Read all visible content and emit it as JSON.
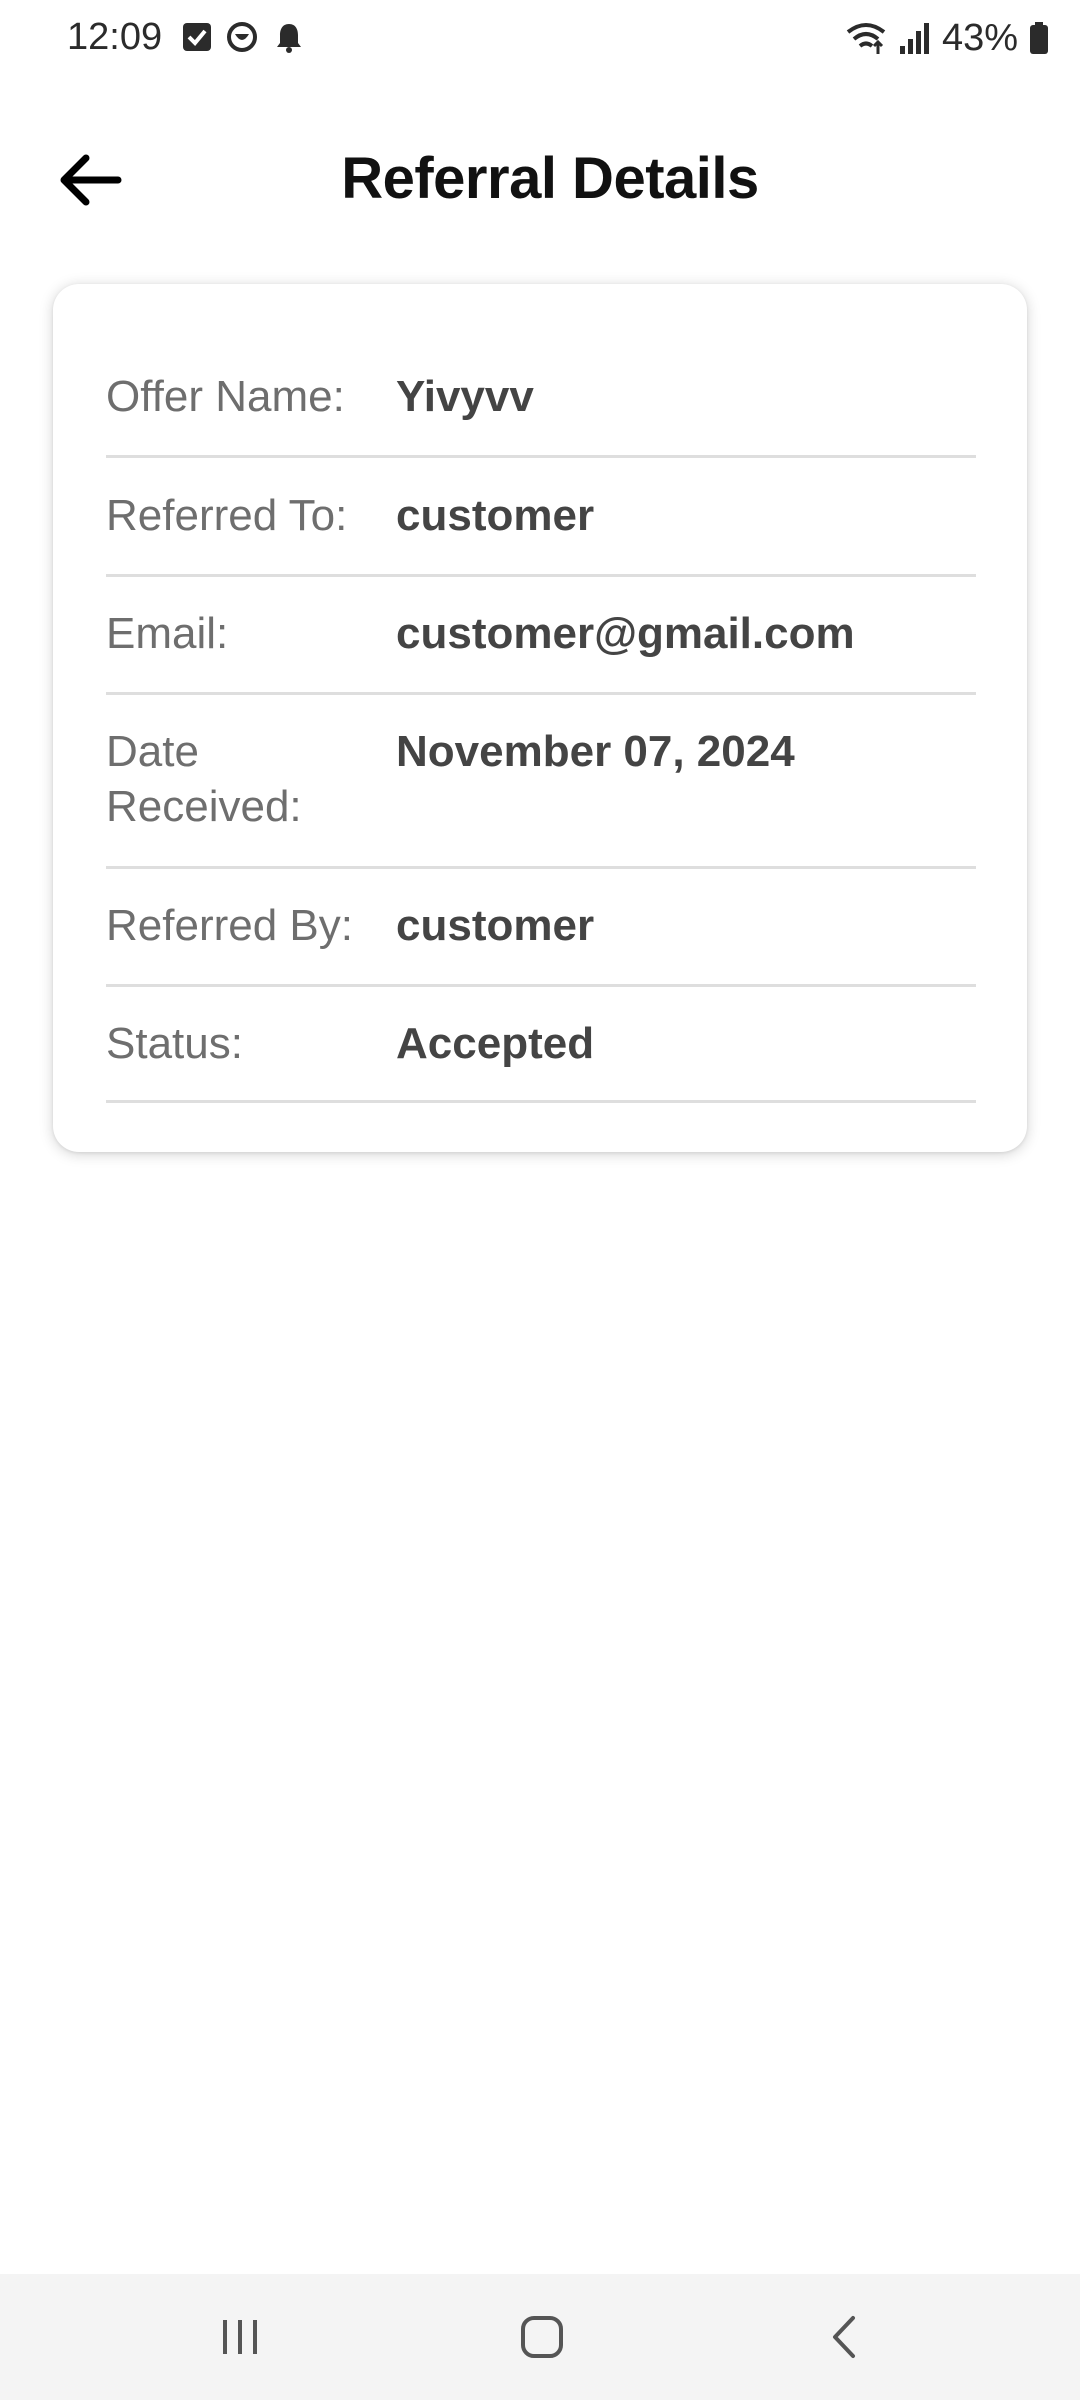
{
  "status_bar": {
    "time": "12:09",
    "battery": "43%",
    "icons": [
      "checkbox-notification-icon",
      "smile-notification-icon",
      "bell-icon",
      "wifi-icon",
      "signal-icon",
      "battery-icon"
    ]
  },
  "header": {
    "title": "Referral Details",
    "back_icon": "arrow-left-icon"
  },
  "details": [
    {
      "label": "Offer Name:",
      "value": "Yivyvv"
    },
    {
      "label": "Referred To:",
      "value": "customer"
    },
    {
      "label": "Email:",
      "value": "customer@gmail.com"
    },
    {
      "label": "Date Received:",
      "value": "November 07, 2024"
    },
    {
      "label": "Referred By:",
      "value": "customer"
    },
    {
      "label": "Status:",
      "value": "Accepted"
    }
  ],
  "nav_bar": {
    "icons": [
      "recent-apps-icon",
      "home-icon",
      "back-icon"
    ]
  },
  "colors": {
    "label": "#6e6e6e",
    "value": "#444444",
    "divider": "#dedede",
    "nav_background": "#f4f4f4"
  }
}
